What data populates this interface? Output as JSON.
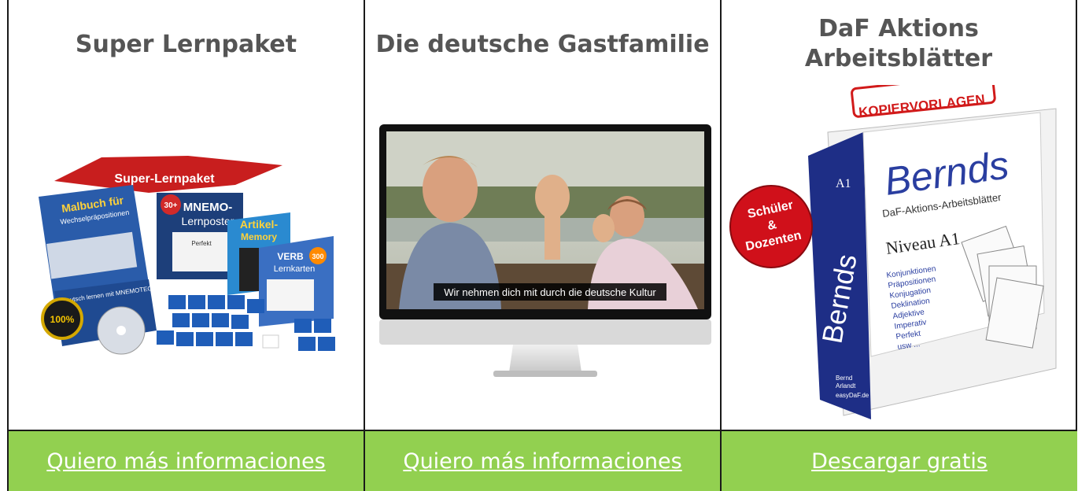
{
  "columns": [
    {
      "title_lines": [
        "Super Lernpaket"
      ],
      "image": {
        "banner": "Super-Lernpaket",
        "book1_title": "Malbuch für",
        "book1_sub": "Wechselpräpositionen",
        "book1_bottom": "Deutsch lernen mit MNEMOTECHNIKEN",
        "poster_badge": "30+",
        "poster_title": "MNEMO-",
        "poster_sub": "Lernposter",
        "poster_caption": "Perfekt",
        "box1_title": "Artikel-",
        "box1_sub": "Memory",
        "box2_title": "VERB",
        "box2_badge": "300",
        "box2_sub": "Lernkarten",
        "seal_text": "100%"
      },
      "link": "Quiero más informaciones"
    },
    {
      "title_lines": [
        "Die deutsche Gastfamilie"
      ],
      "image": {
        "subtitle": "Wir nehmen dich mit durch die deutsche Kultur"
      },
      "link": "Quiero más informaciones"
    },
    {
      "title_lines": [
        "DaF Aktions",
        "Arbeitsblätter"
      ],
      "image": {
        "stamp": "KOPIERVORLAGEN",
        "brand": "Bernds",
        "level_tag": "A1",
        "subtitle": "DaF-Aktions-Arbeitsblätter",
        "level": "Niveau A1",
        "topics": [
          "Konjunktionen",
          "Präpositionen",
          "Konjugation",
          "Deklination",
          "Adjektive",
          "Imperativ",
          "Perfekt",
          "usw ..."
        ],
        "badge_line1": "Schüler",
        "badge_line2": "&",
        "badge_line3": "Dozenten",
        "spine": "Bernds",
        "author1": "Bernd",
        "author2": "Arlandt",
        "publisher": "easyDaF.de"
      },
      "link": "Descargar gratis"
    }
  ],
  "colors": {
    "title": "#555555",
    "button_bg": "#92d050",
    "link": "#ffffff",
    "border": "#1a1a1a"
  }
}
